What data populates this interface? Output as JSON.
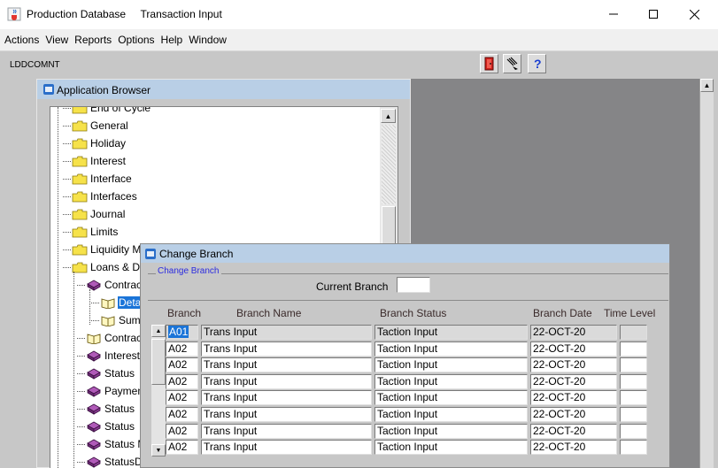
{
  "window": {
    "title": "Production Database",
    "subtitle": "Transaction Input"
  },
  "menu": [
    "Actions",
    "View",
    "Reports",
    "Options",
    "Help",
    "Window"
  ],
  "toolbar": {
    "form_code": "LDDCOMNT",
    "buttons": [
      "exit-door-icon",
      "erase-icon",
      "help-question-icon"
    ]
  },
  "app_browser": {
    "title": "Application Browser",
    "tree": [
      {
        "label": "End of Cycle",
        "icon": "folder-icon"
      },
      {
        "label": "General",
        "icon": "folder-icon"
      },
      {
        "label": "Holiday",
        "icon": "folder-icon"
      },
      {
        "label": "Interest",
        "icon": "folder-icon"
      },
      {
        "label": "Interface",
        "icon": "folder-icon"
      },
      {
        "label": "Interfaces",
        "icon": "folder-icon"
      },
      {
        "label": "Journal",
        "icon": "folder-icon"
      },
      {
        "label": "Limits",
        "icon": "folder-icon"
      },
      {
        "label": "Liquidity Ma",
        "icon": "folder-icon"
      },
      {
        "label": "Loans & De",
        "icon": "folder-icon"
      },
      {
        "label": "Contrac",
        "icon": "cube-icon"
      },
      {
        "label": "Deta",
        "icon": "book-icon",
        "selected": true
      },
      {
        "label": "Sum",
        "icon": "book-icon"
      },
      {
        "label": "Contrac",
        "icon": "book-icon"
      },
      {
        "label": "Interest",
        "icon": "cube-icon"
      },
      {
        "label": "Status",
        "icon": "cube-icon"
      },
      {
        "label": "Paymen",
        "icon": "cube-icon"
      },
      {
        "label": "Status",
        "icon": "cube-icon"
      },
      {
        "label": "Status",
        "icon": "cube-icon"
      },
      {
        "label": "Status M",
        "icon": "cube-icon"
      },
      {
        "label": "StatusD",
        "icon": "cube-icon"
      }
    ]
  },
  "change_branch": {
    "title": "Change Branch",
    "group_label": "Change Branch",
    "current_branch_label": "Current Branch",
    "current_branch_value": "",
    "columns": [
      "Branch",
      "Branch Name",
      "Branch Status",
      "Branch Date",
      "Time Level"
    ],
    "rows": [
      {
        "branch": "A01",
        "name": "Trans Input",
        "status": "Taction Input",
        "date": "22-OCT-20",
        "time_level": ""
      },
      {
        "branch": "A02",
        "name": "Trans Input",
        "status": "Taction Input",
        "date": "22-OCT-20",
        "time_level": ""
      },
      {
        "branch": "A02",
        "name": "Trans Input",
        "status": "Taction Input",
        "date": "22-OCT-20",
        "time_level": ""
      },
      {
        "branch": "A02",
        "name": "Trans Input",
        "status": "Taction Input",
        "date": "22-OCT-20",
        "time_level": ""
      },
      {
        "branch": "A02",
        "name": "Trans Input",
        "status": "Taction Input",
        "date": "22-OCT-20",
        "time_level": ""
      },
      {
        "branch": "A02",
        "name": "Trans Input",
        "status": "Taction Input",
        "date": "22-OCT-20",
        "time_level": ""
      },
      {
        "branch": "A02",
        "name": "Trans Input",
        "status": "Taction Input",
        "date": "22-OCT-20",
        "time_level": ""
      },
      {
        "branch": "A02",
        "name": "Trans Input",
        "status": "Taction Input",
        "date": "22-OCT-20",
        "time_level": ""
      }
    ]
  },
  "colors": {
    "title_bar_blue": "#b9cfe6",
    "selection_blue": "#1a74d8",
    "workspace_gray": "#c7c7c7",
    "mdi_dark_gray": "#858587"
  }
}
